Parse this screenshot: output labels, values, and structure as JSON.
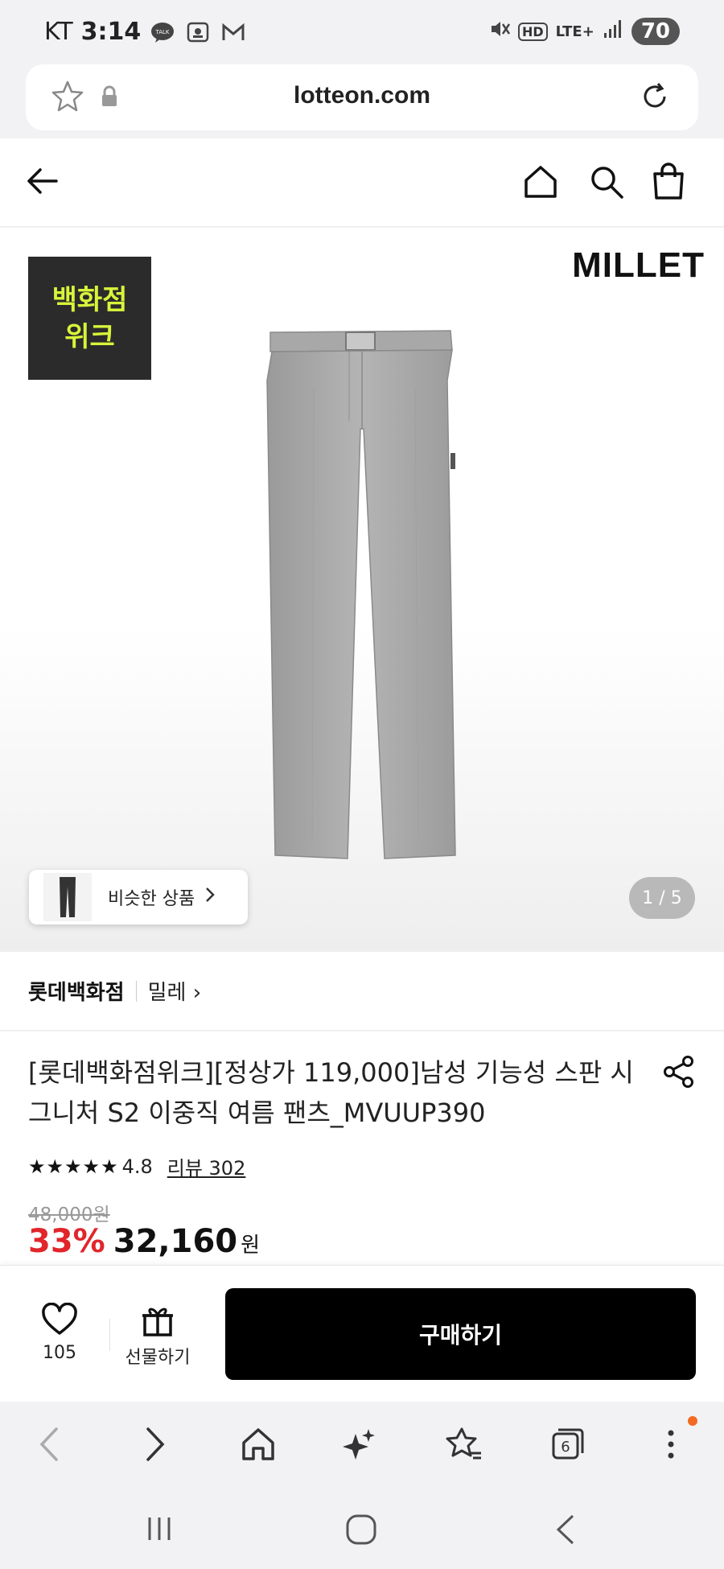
{
  "status_bar": {
    "carrier": "KT",
    "time": "3:14",
    "battery": "70",
    "network": "LTE+",
    "hd_label": "HD",
    "talk_label": "TALK"
  },
  "browser": {
    "url": "lotteon.com",
    "tab_count": "6"
  },
  "gallery": {
    "promo_line1": "백화점",
    "promo_line2": "위크",
    "brand_logo": "MILLET",
    "similar_label": "비슷한 상품",
    "page_indicator": "1 / 5"
  },
  "seller": {
    "name": "롯데백화점",
    "brand": "밀레",
    "chevron": "›"
  },
  "product": {
    "title": "[롯데백화점위크][정상가 119,000]남성 기능성 스판 시그니처 S2 이중직 여름 팬츠_MVUUP390",
    "stars": "★★★★★",
    "rating": "4.8",
    "review_link": "리뷰 302",
    "original_price": "48,000원",
    "discount": "33%",
    "price": "32,160",
    "currency": "원"
  },
  "actions": {
    "like_count": "105",
    "gift_label": "선물하기",
    "buy_label": "구매하기"
  },
  "colors": {
    "accent_red": "#e0262b",
    "buy_button": "#000000",
    "promo_text": "#d8f43a",
    "notification_dot": "#f26b21"
  }
}
